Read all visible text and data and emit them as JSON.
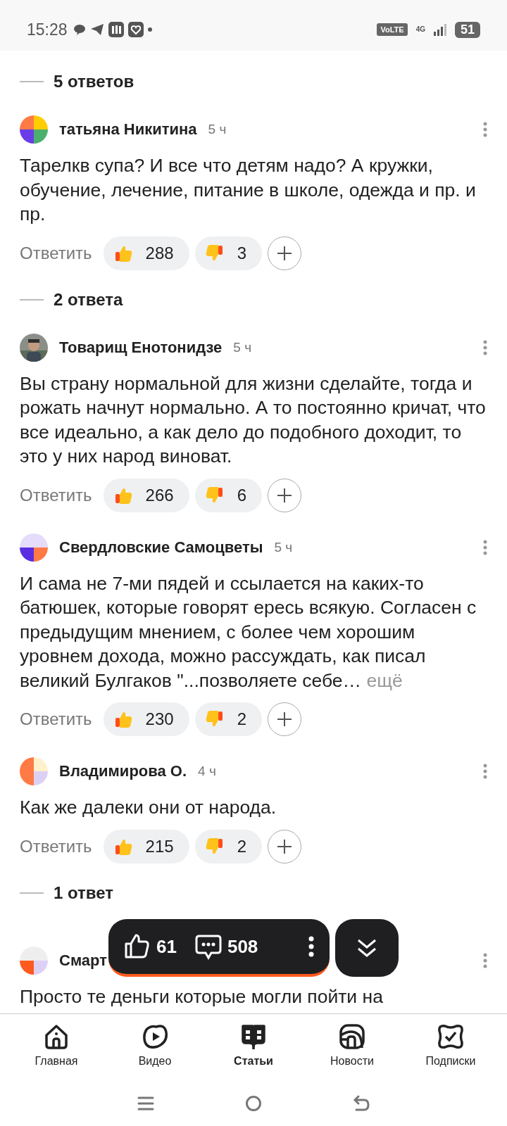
{
  "status_bar": {
    "time": "15:28",
    "volte": "VoLTE",
    "network": "4G",
    "battery": "51"
  },
  "feed": [
    {
      "kind": "replies",
      "label": "5 ответов"
    },
    {
      "kind": "comment",
      "author": "татьяна Никитина",
      "time": "5 ч",
      "avatar": {
        "kind": "mosaic"
      },
      "text": "Тарелкв супа? И все что детям надо? А кружки, обучение, лечение, питание в школе, одежда и пр. и пр.",
      "reply": "Ответить",
      "likes": "288",
      "dislikes": "3"
    },
    {
      "kind": "replies",
      "label": "2 ответа"
    },
    {
      "kind": "comment",
      "author": "Товарищ Енотонидзе",
      "time": "5 ч",
      "text": "Вы страну нормальной для жизни сделайте, тогда и рожать начнут нормально. А то постоянно кричат, что все идеально, а как дело до подобного доходит, то это у них народ виноват.",
      "reply": "Ответить",
      "likes": "266",
      "dislikes": "6"
    },
    {
      "kind": "comment",
      "author": "Свердловские Самоцветы",
      "time": "5 ч",
      "avatar": {
        "kind": "mosaic"
      },
      "text": "И сама не 7-ми пядей и ссылается на каких-то батюшек, которые говорят ересь всякую. Согласен с предыдущим мнением, с более чем хорошим уровнем дохода, можно рассуждать, как писал великий Булгаков \"...позволяете себе…",
      "more": "ещё",
      "reply": "Ответить",
      "likes": "230",
      "dislikes": "2"
    },
    {
      "kind": "comment",
      "author": "Владимирова О.",
      "time": "4 ч",
      "avatar": {
        "kind": "mosaic"
      },
      "text": "Как же далеки они от народа.",
      "reply": "Ответить",
      "likes": "215",
      "dislikes": "2"
    },
    {
      "kind": "replies",
      "label": "1 ответ"
    },
    {
      "kind": "comment",
      "author": "Смарт",
      "avatar": {
        "kind": "mosaic"
      },
      "text": "Просто те деньги которые могли пойти на"
    }
  ],
  "floating_bar": {
    "likes": "61",
    "comments": "508"
  },
  "bottom_nav": [
    {
      "label": "Главная",
      "selected": false
    },
    {
      "label": "Видео",
      "selected": false
    },
    {
      "label": "Статьи",
      "selected": true
    },
    {
      "label": "Новости",
      "selected": false
    },
    {
      "label": "Подписки",
      "selected": false
    }
  ]
}
